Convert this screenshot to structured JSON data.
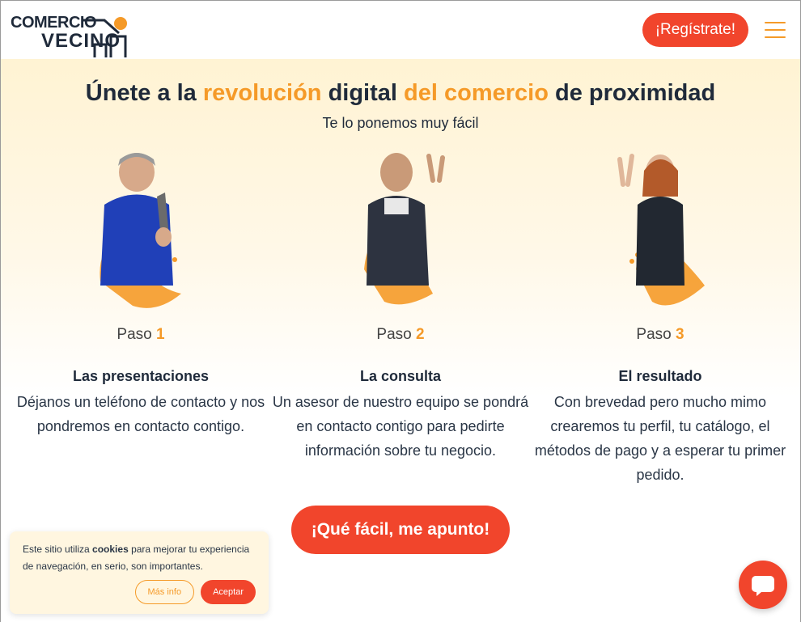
{
  "header": {
    "logo_line1": "COMERCIO",
    "logo_line2": "VECINO",
    "register_label": "¡Regístrate!"
  },
  "hero": {
    "title_part1": "Únete a la ",
    "title_accent1": "revolución",
    "title_part2": " digital ",
    "title_accent2": "del comercio",
    "title_part3": " de proximidad",
    "subtitle": "Te lo ponemos muy fácil"
  },
  "steps": [
    {
      "paso_label": "Paso",
      "number": "1",
      "title": "Las presentaciones",
      "description": "Déjanos un teléfono de contacto y nos pondremos en contacto contigo."
    },
    {
      "paso_label": "Paso",
      "number": "2",
      "title": "La consulta",
      "description": "Un asesor de nuestro equipo se pondrá en contacto contigo para pedirte información sobre tu negocio."
    },
    {
      "paso_label": "Paso",
      "number": "3",
      "title": "El resultado",
      "description": "Con brevedad pero mucho mimo crearemos tu perfil, tu catálogo, el métodos de pago y a esperar tu primer pedido."
    }
  ],
  "cta_label": "¡Qué fácil, me apunto!",
  "cookie": {
    "text_before": "Este sitio utiliza ",
    "text_bold": "cookies",
    "text_after": " para mejorar tu experiencia de navegación, en serio, son importantes.",
    "more_label": "Más info",
    "accept_label": "Aceptar"
  },
  "colors": {
    "accent_orange": "#f59a28",
    "button_red": "#f1452c",
    "text_dark": "#1f2a3a"
  },
  "icons": {
    "menu": "hamburger-icon",
    "chat": "chat-bubble-icon"
  }
}
